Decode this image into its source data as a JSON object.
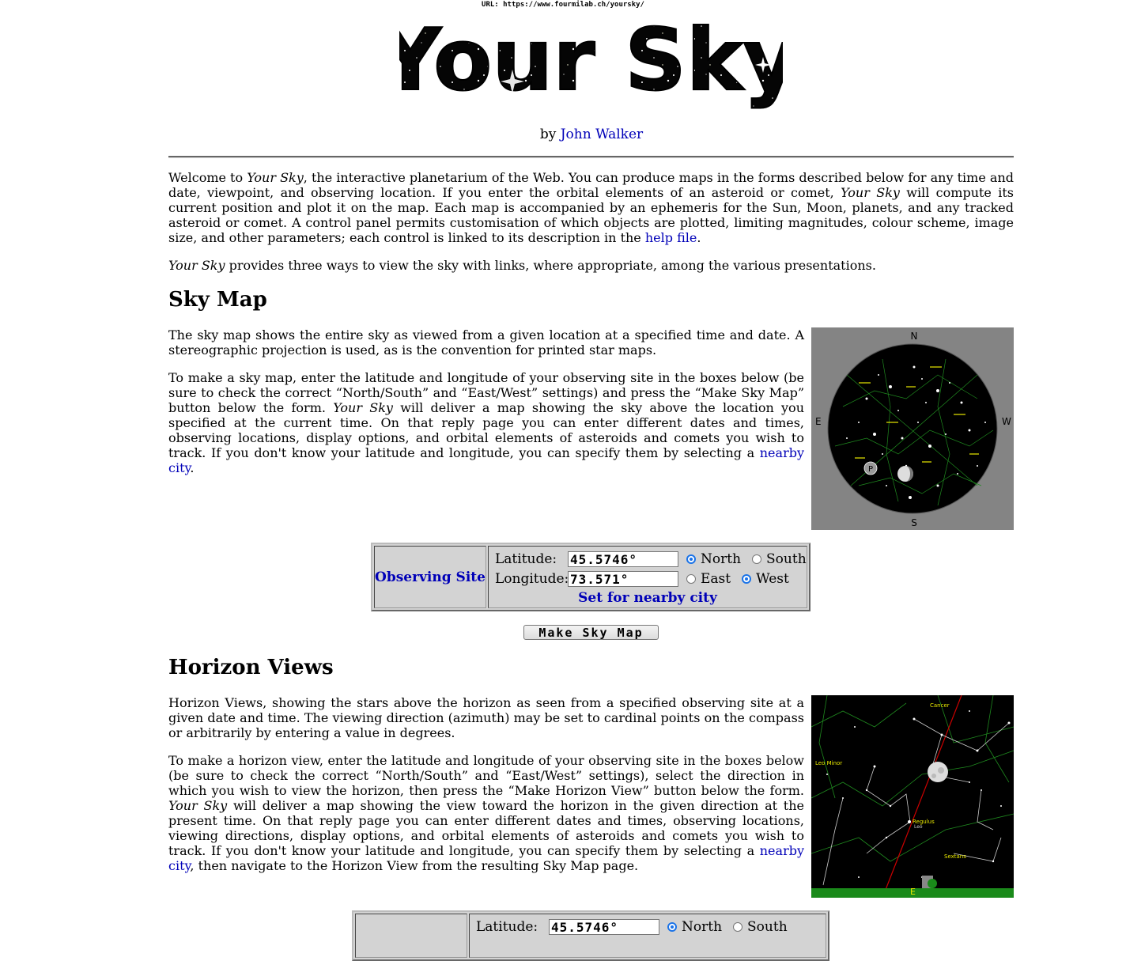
{
  "url_bar": "URL: https://www.fourmilab.ch/yoursky/",
  "logo": {
    "text": "Your Sky"
  },
  "byline": {
    "prefix": "by ",
    "author": "John Walker"
  },
  "intro": {
    "p1_a": "Welcome to ",
    "p1_em1": "Your Sky",
    "p1_b": ", the interactive planetarium of the Web. You can produce maps in the forms described below for any time and date, viewpoint, and observing location. If you enter the orbital elements of an asteroid or comet, ",
    "p1_em2": "Your Sky",
    "p1_c": " will compute its current position and plot it on the map. Each map is accompanied by an ephemeris for the Sun, Moon, planets, and any tracked asteroid or comet. A control panel permits customisation of which objects are plotted, limiting magnitudes, colour scheme, image size, and other parameters; each control is linked to its description in the ",
    "p1_link": "help file",
    "p1_d": ".",
    "p2_em": "Your Sky",
    "p2_rest": " provides three ways to view the sky with links, where appropriate, among the various presentations."
  },
  "sky_map": {
    "heading": "Sky Map",
    "p1": "The sky map shows the entire sky as viewed from a given location at a specified time and date. A stereographic projection is used, as is the convention for printed star maps.",
    "p2_a": "To make a sky map, enter the latitude and longitude of your observing site in the boxes below (be sure to check the correct “North/South” and “East/West” settings) and press the “Make Sky Map” button below the form. ",
    "p2_em": "Your Sky",
    "p2_b": " will deliver a map showing the sky above the location you specified at the current time. On that reply page you can enter different dates and times, observing locations, display options, and orbital elements of asteroids and comets you wish to track. If you don't know your latitude and longitude, you can specify them by selecting a ",
    "p2_link": "nearby city",
    "p2_c": ".",
    "compass": {
      "n": "N",
      "s": "S",
      "e": "E",
      "w": "W"
    },
    "form": {
      "site_label": "Observing Site",
      "lat_label": "Latitude:",
      "lat_value": "45.5746°",
      "north": "North",
      "south": "South",
      "lon_label": "Longitude:",
      "lon_value": "73.571°",
      "east": "East",
      "west": "West",
      "nearby": "Set for nearby city"
    },
    "button": "Make Sky Map"
  },
  "horizon": {
    "heading": "Horizon Views",
    "p1": "Horizon Views, showing the stars above the horizon as seen from a specified observing site at a given date and time. The viewing direction (azimuth) may be set to cardinal points on the compass or arbitrarily by entering a value in degrees.",
    "p2_a": "To make a horizon view, enter the latitude and longitude of your observing site in the boxes below (be sure to check the correct “North/South” and “East/West” settings), select the direction in which you wish to view the horizon, then press the “Make Horizon View” button below the form. ",
    "p2_em": "Your Sky",
    "p2_b": " will deliver a map showing the view toward the horizon in the given direction at the present time. On that reply page you can enter different dates and times, observing locations, viewing directions, display options, and orbital elements of asteroids and comets you wish to track. If you don't know your latitude and longitude, you can specify them by selecting a ",
    "p2_link": "nearby city",
    "p2_c": ", then navigate to the Horizon View from the resulting Sky Map page.",
    "image_labels": {
      "cancer": "Cancer",
      "leo_minor": "Leo Minor",
      "regulus": "Regulus",
      "sextans": "Sextans",
      "leo": "Leo",
      "east": "E"
    },
    "form": {
      "lat_label": "Latitude:",
      "lat_value": "45.5746°",
      "north": "North",
      "south": "South"
    }
  },
  "colors": {
    "link": "#0000b8",
    "form_bg": "#d3d3d3",
    "radio_on": "#1a73e8"
  }
}
